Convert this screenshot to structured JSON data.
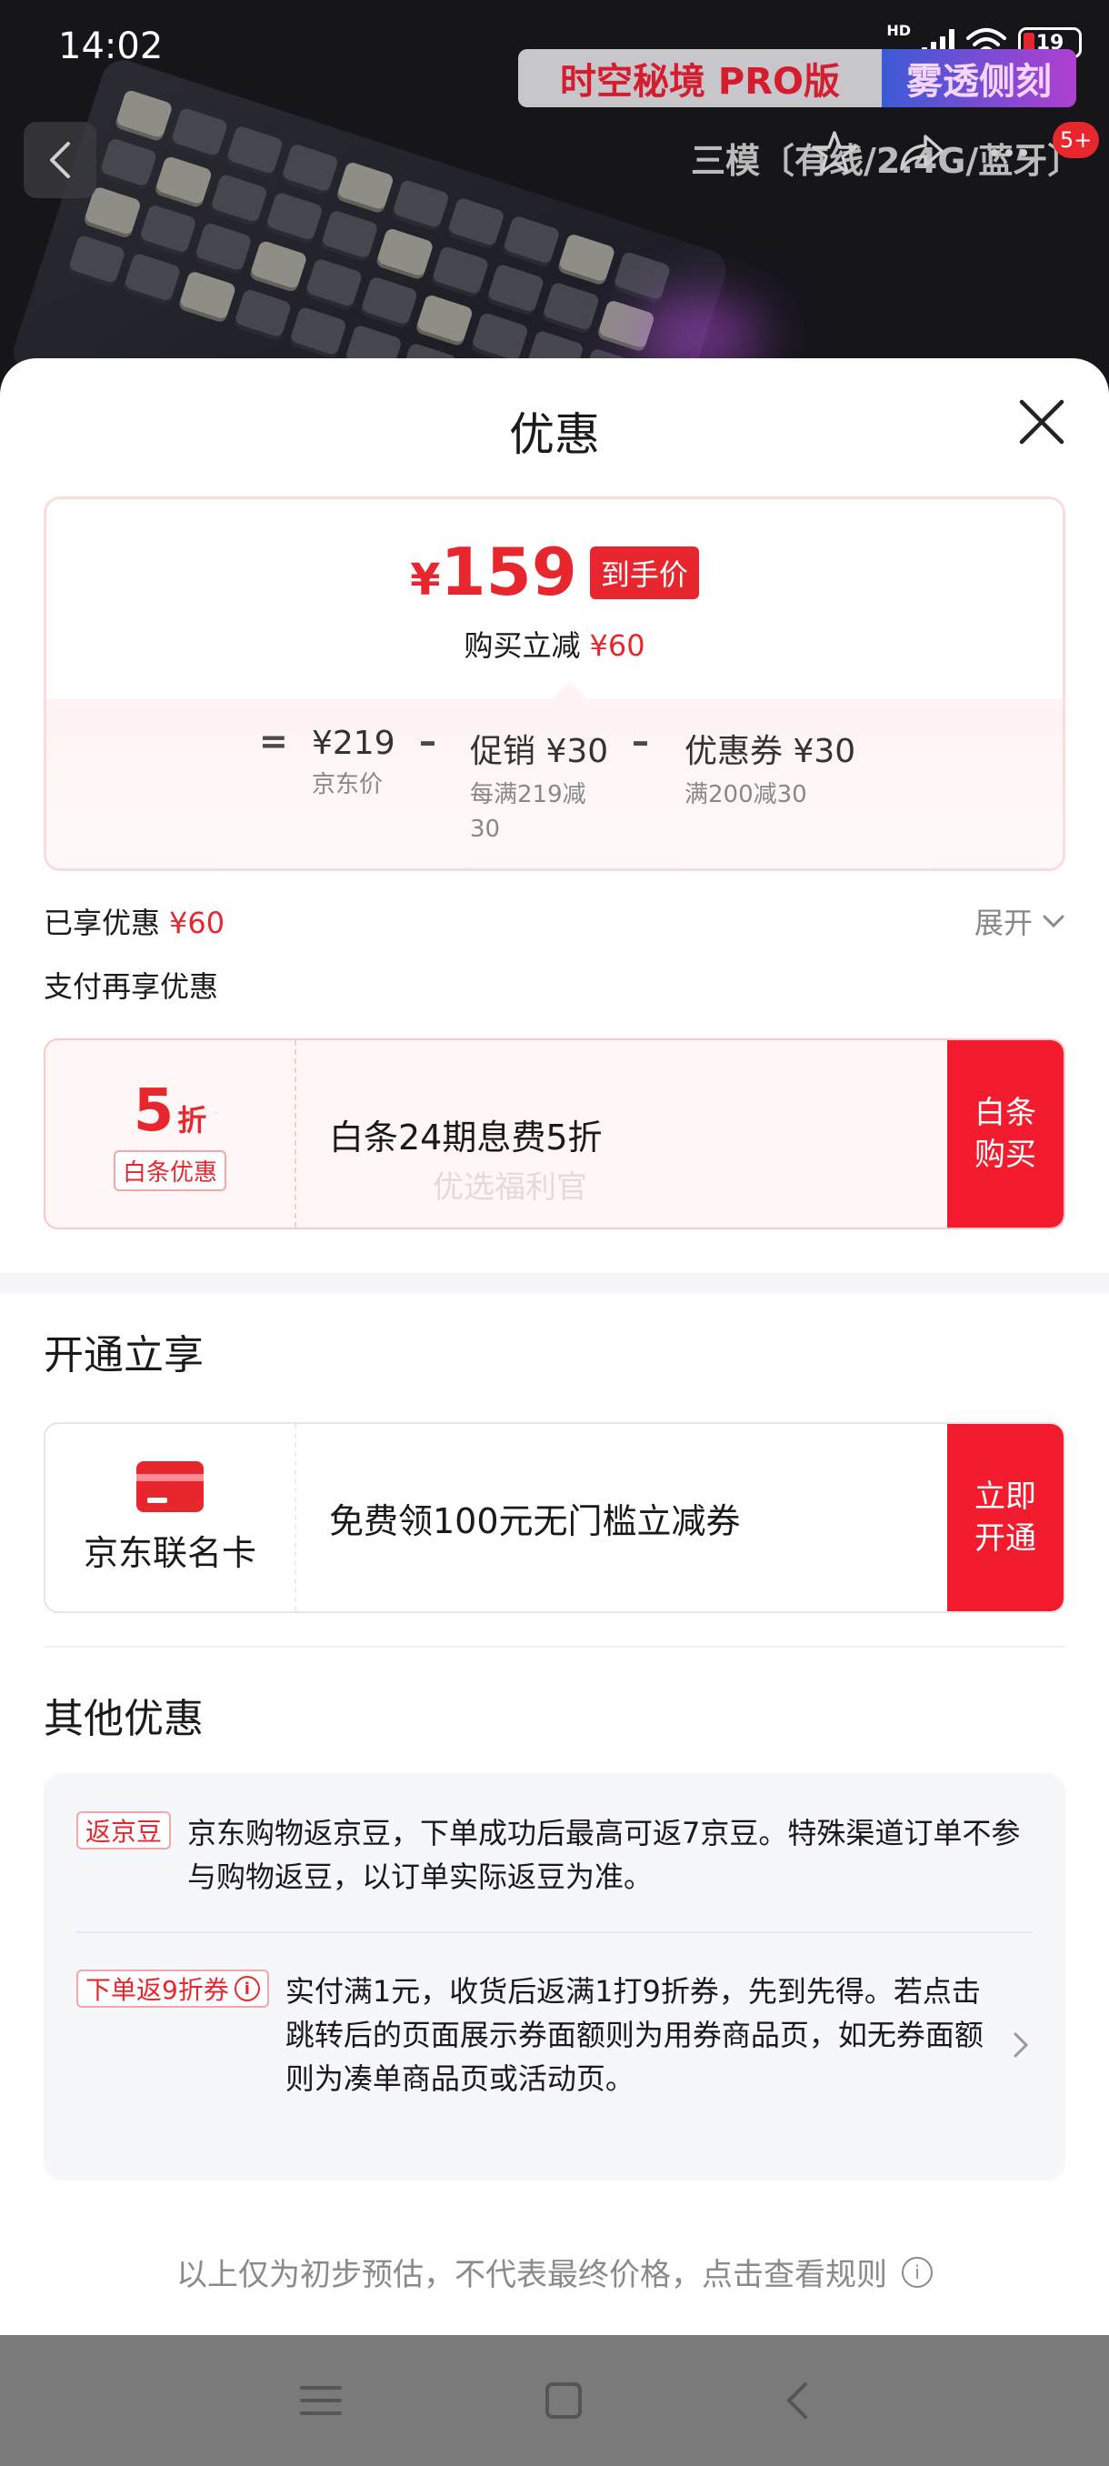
{
  "status_bar": {
    "time": "14:02",
    "network": "HD",
    "wifi_sub": "6",
    "battery": "19"
  },
  "background": {
    "banner_left": "时空秘境 PRO版",
    "banner_right": "雾透侧刻",
    "product_title": "三模〔有线/2.4G/蓝牙〕",
    "badge": "5+"
  },
  "sheet": {
    "title": "优惠",
    "price": {
      "currency": "¥",
      "amount": "159",
      "tag": "到手价",
      "save_label": "购买立减",
      "save_value": "¥60",
      "equals": "=",
      "minus": "–",
      "items": [
        {
          "label": "¥219",
          "sub": "京东价"
        },
        {
          "label": "促销 ¥30",
          "sub": "每满219减30"
        },
        {
          "label": "优惠券 ¥30",
          "sub": "满200减30"
        }
      ]
    },
    "enjoyed_label": "已享优惠",
    "enjoyed_value": "¥60",
    "expand_label": "展开",
    "pay_more_label": "支付再享优惠",
    "baitiao": {
      "discount_num": "5",
      "discount_unit": "折",
      "badge": "白条优惠",
      "desc": "白条24期息费5折",
      "watermark": "优选福利官",
      "button": "白条购买"
    },
    "open_section_title": "开通立享",
    "jd_card": {
      "name": "京东联名卡",
      "desc": "免费领100元无门槛立减券",
      "button": "立即开通"
    },
    "other_section_title": "其他优惠",
    "other": [
      {
        "tag": "返京豆",
        "text": "京东购物返京豆，下单成功后最高可返7京豆。特殊渠道订单不参与购物返豆，以订单实际返豆为准。"
      },
      {
        "tag": "下单返9折券",
        "text": "实付满1元，收货后返满1打9折券，先到先得。若点击跳转后的页面展示券面额则为用券商品页，如无券面额则为凑单商品页或活动页。"
      }
    ],
    "footer_note": "以上仅为初步预估，不代表最终价格，点击查看规则"
  },
  "colors": {
    "accent": "#e8262e",
    "button_red": "#f31c2e"
  }
}
